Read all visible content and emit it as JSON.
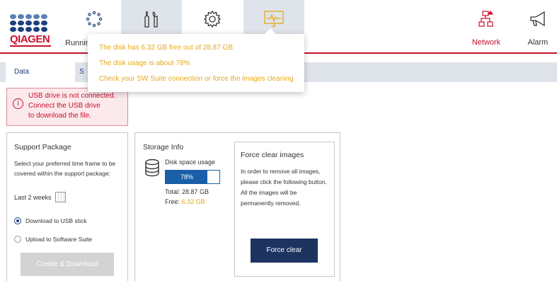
{
  "header": {
    "logo_text": "QIAGEN",
    "running_label": "Runnin",
    "network_label": "Network",
    "alarm_label": "Alarm"
  },
  "tabs": [
    {
      "label": "Data Management"
    },
    {
      "label": "S"
    }
  ],
  "tooltip": {
    "line1": "The disk has 6.32 GB free out of 28.87 GB",
    "line2": "The disk usage is about 78%",
    "line3": "Check your SW Suite connection or force the images cleaning"
  },
  "alert": {
    "icon": "info-circle-icon",
    "line1": "USB drive is not connected.",
    "line2": "Connect the USB drive",
    "line3": "to download the file."
  },
  "support": {
    "title": "Support Package",
    "description": "Select your preferred time frame to be covered within the support package:",
    "period": "Last 2 weeks",
    "option_usb": "Download to USB stick",
    "option_suite": "Upload to Software Suite",
    "button_label": "Create & Download"
  },
  "storage": {
    "title": "Storage Info",
    "usage_label": "Disk space usage",
    "usage_percent_text": "78%",
    "usage_fraction": 0.78,
    "total_text": "Total: 28.87 GB",
    "free_prefix": "Free: ",
    "free_value": "6.32 GB"
  },
  "force_clear": {
    "title": "Force clear images",
    "description": "In order to remove all images, please click the following button. All the images will be permanently removed.",
    "button_label": "Force clear"
  },
  "colors": {
    "brand_red": "#c8102e",
    "brand_blue": "#1a3f7a",
    "warning_amber": "#e5a81c",
    "primary_button": "#1d3461"
  }
}
